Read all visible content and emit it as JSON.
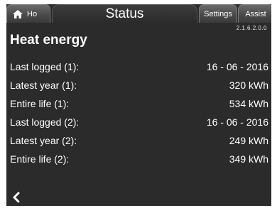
{
  "tabs": {
    "home_label": "Ho",
    "status_label": "Status",
    "settings_label": "Settings",
    "assist_label": "Assist"
  },
  "version": "2.1.6.2.0.0",
  "page_title": "Heat energy",
  "rows": [
    {
      "label": "Last logged (1):",
      "value": "16 - 06 - 2016"
    },
    {
      "label": "Latest year (1):",
      "value": "320 kWh"
    },
    {
      "label": "Entire life (1):",
      "value": "534 kWh"
    },
    {
      "label": "Last logged (2):",
      "value": "16 - 06 - 2016"
    },
    {
      "label": "Latest year (2):",
      "value": "249 kWh"
    },
    {
      "label": "Entire life (2):",
      "value": "349 kWh"
    }
  ],
  "icons": {
    "home": "home-icon",
    "back": "chevron-left-icon"
  },
  "colors": {
    "background": "#2b2b2b",
    "text": "#ffffff"
  }
}
